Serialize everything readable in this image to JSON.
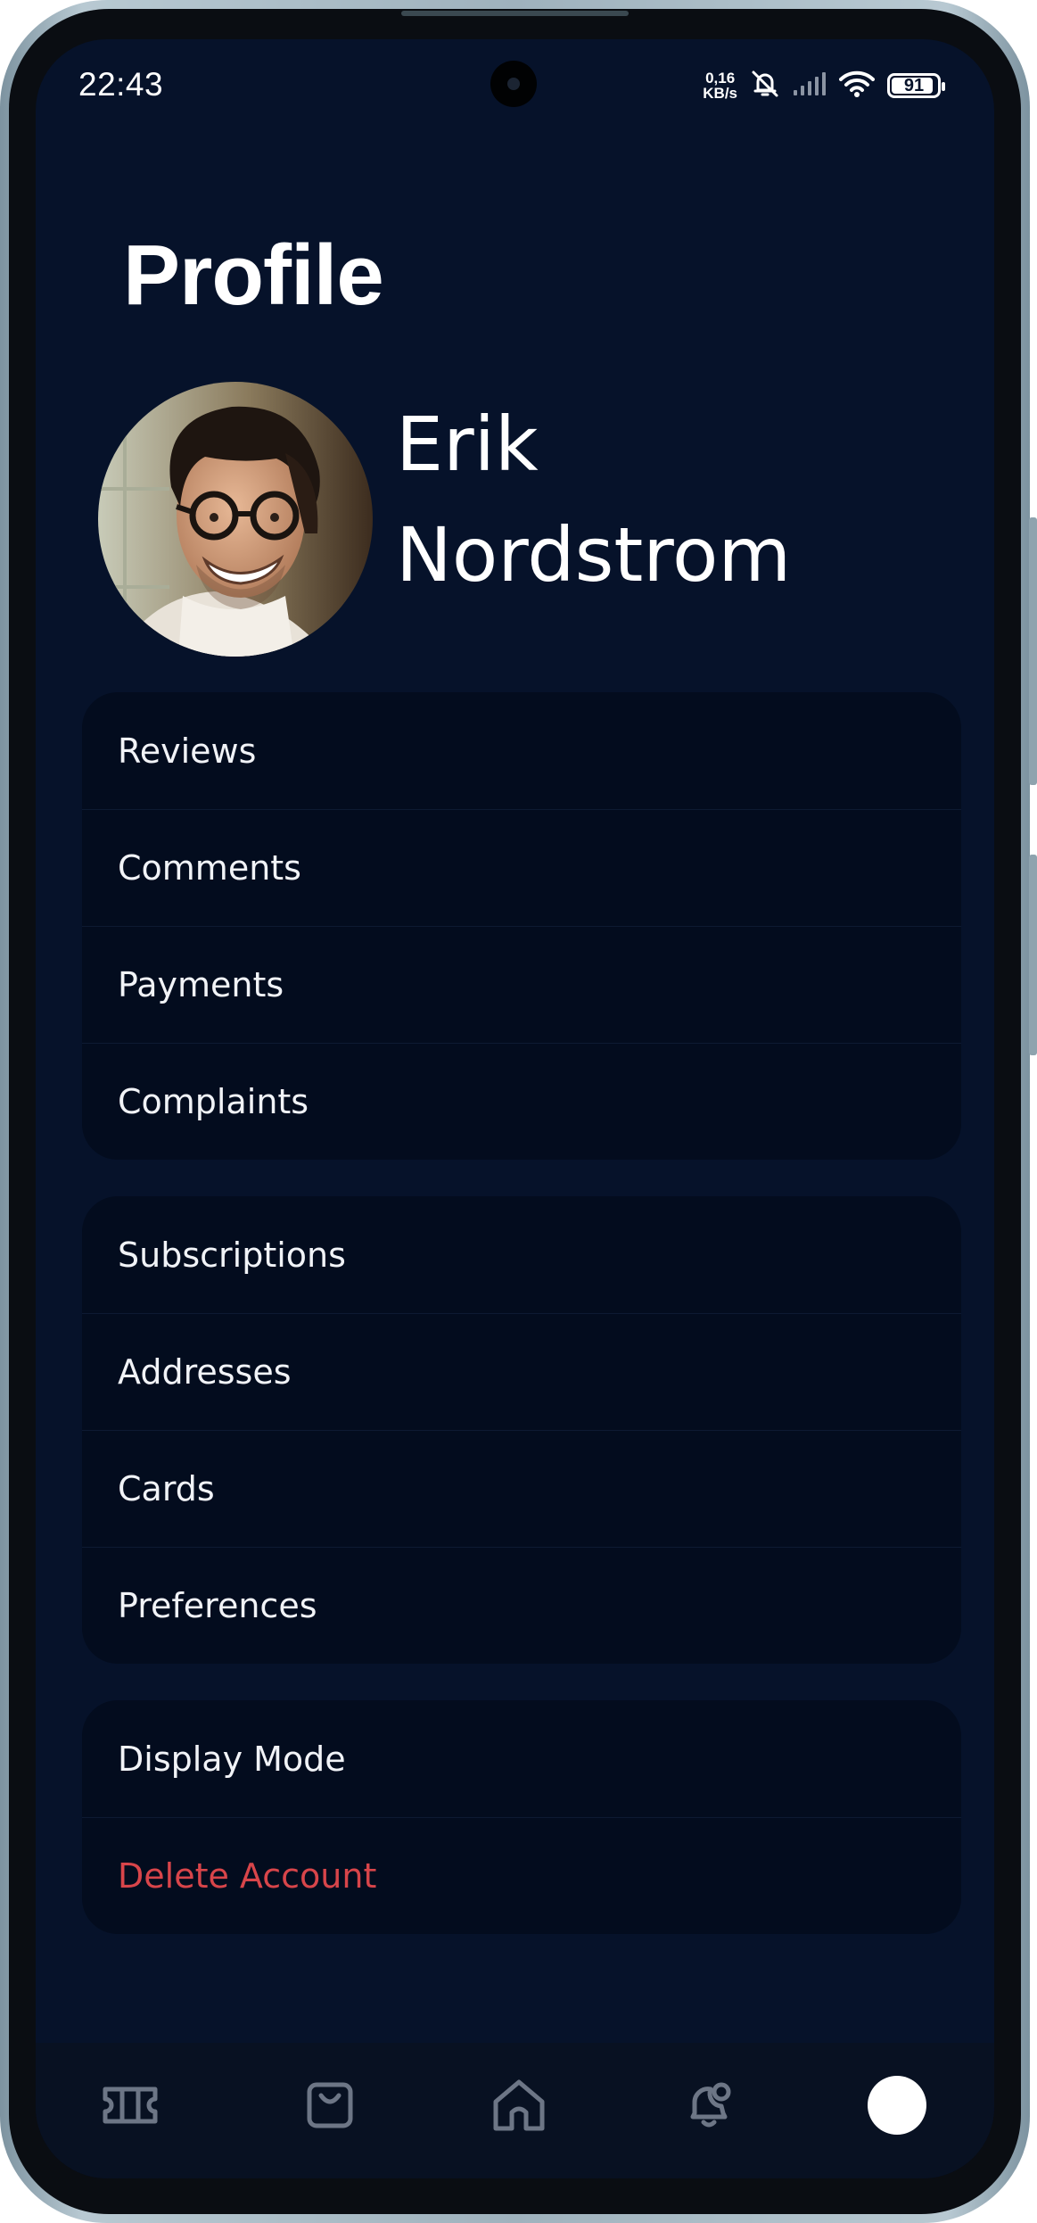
{
  "status_bar": {
    "time": "22:43",
    "net_speed_value": "0,16",
    "net_speed_unit": "KB/s",
    "battery_level": "91",
    "battery_fraction": 0.91,
    "icons": [
      "mute-icon",
      "signal-icon",
      "wifi-icon",
      "battery-icon"
    ]
  },
  "page": {
    "title": "Profile"
  },
  "profile": {
    "name": "Erik Nordstrom"
  },
  "groups": [
    {
      "items": [
        "Reviews",
        "Comments",
        "Payments",
        "Complaints"
      ]
    },
    {
      "items": [
        "Subscriptions",
        "Addresses",
        "Cards",
        "Preferences"
      ]
    },
    {
      "items": [
        "Display Mode",
        "Delete Account"
      ]
    }
  ],
  "bottom_nav": {
    "items": [
      "ticket-icon",
      "bag-icon",
      "home-icon",
      "bell-icon",
      "profile-avatar"
    ],
    "active": "profile-avatar"
  },
  "colors": {
    "background": "#06122a",
    "card": "#030c1e",
    "text": "#f1f3f7",
    "danger": "#d8454a",
    "nav_icon": "#6d7686"
  }
}
